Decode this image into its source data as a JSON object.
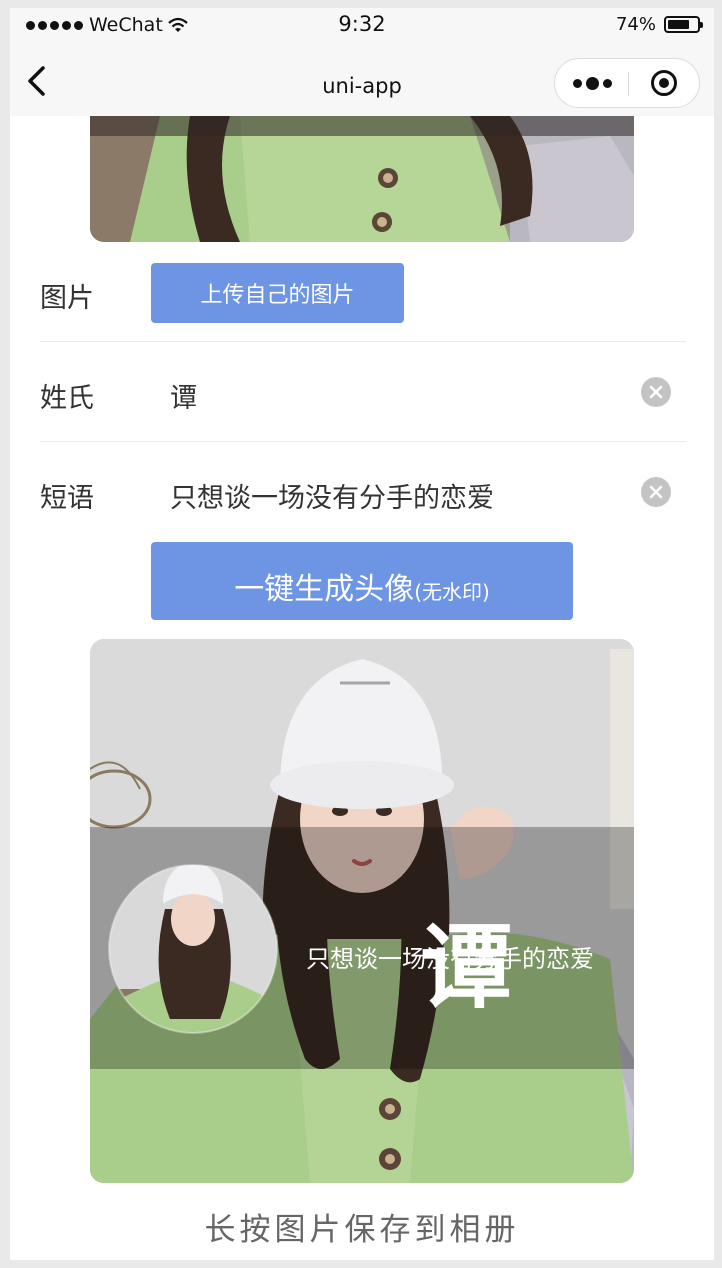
{
  "status_bar": {
    "carrier": "WeChat",
    "time": "9:32",
    "battery_percent": "74%",
    "battery_level": 0.74
  },
  "nav": {
    "title": "uni-app",
    "back_icon": "chevron-left-icon",
    "more_icon": "more-dots-icon",
    "close_icon": "target-circle-icon"
  },
  "form": {
    "image_label": "图片",
    "upload_button": "上传自己的图片",
    "surname_label": "姓氏",
    "surname_value": "谭",
    "phrase_label": "短语",
    "phrase_value": "只想谈一场没有分手的恋爱",
    "clear_icon": "clear-circle-icon"
  },
  "generate_button": {
    "main": "一键生成头像",
    "sub": "(无水印)"
  },
  "result": {
    "surname_overlay": "谭",
    "phrase_overlay": "只想谈一场没有分手的恋爱"
  },
  "save_hint": "长按图片保存到相册",
  "colors": {
    "accent_button": "#6d95e3",
    "sweater": "#a9cd8a",
    "background": "#ffffff"
  }
}
